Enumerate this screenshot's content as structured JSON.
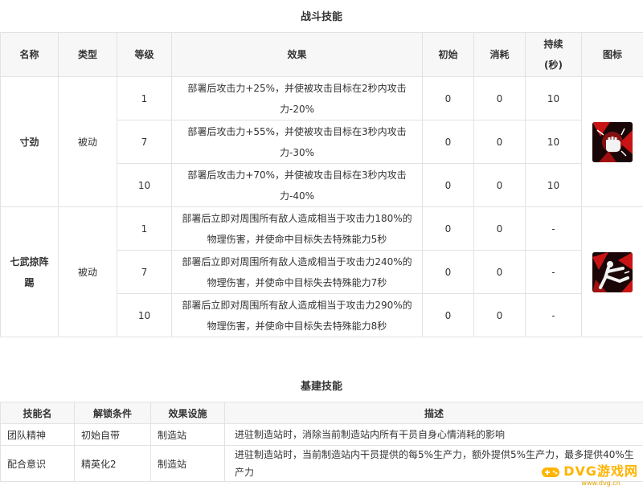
{
  "combat": {
    "title": "战斗技能",
    "headers": {
      "name": "名称",
      "type": "类型",
      "level": "等级",
      "effect": "效果",
      "initial": "初始",
      "cost": "消耗",
      "duration_line1": "持续",
      "duration_line2": "(秒)",
      "icon": "图标"
    },
    "skills": [
      {
        "name": "寸劲",
        "type": "被动",
        "icon": "fist-strike-icon",
        "rows": [
          {
            "level": "1",
            "effect": "部署后攻击力+25%，并使被攻击目标在2秒内攻击力-20%",
            "initial": "0",
            "cost": "0",
            "duration": "10"
          },
          {
            "level": "7",
            "effect": "部署后攻击力+55%，并使被攻击目标在3秒内攻击力-30%",
            "initial": "0",
            "cost": "0",
            "duration": "10"
          },
          {
            "level": "10",
            "effect": "部署后攻击力+70%，并使被攻击目标在3秒内攻击力-40%",
            "initial": "0",
            "cost": "0",
            "duration": "10"
          }
        ]
      },
      {
        "name_line1": "七武掠阵",
        "name_line2": "踢",
        "type": "被动",
        "icon": "kick-strike-icon",
        "rows": [
          {
            "level": "1",
            "effect": "部署后立即对周围所有敌人造成相当于攻击力180%的物理伤害，并使命中目标失去特殊能力5秒",
            "initial": "0",
            "cost": "0",
            "duration": "-"
          },
          {
            "level": "7",
            "effect": "部署后立即对周围所有敌人造成相当于攻击力240%的物理伤害，并使命中目标失去特殊能力7秒",
            "initial": "0",
            "cost": "0",
            "duration": "-"
          },
          {
            "level": "10",
            "effect": "部署后立即对周围所有敌人造成相当于攻击力290%的物理伤害，并使命中目标失去特殊能力8秒",
            "initial": "0",
            "cost": "0",
            "duration": "-"
          }
        ]
      }
    ]
  },
  "base": {
    "title": "基建技能",
    "headers": {
      "skill": "技能名",
      "unlock": "解锁条件",
      "facility": "效果设施",
      "desc": "描述"
    },
    "rows": [
      {
        "skill": "团队精神",
        "unlock": "初始自带",
        "facility": "制造站",
        "desc": "进驻制造站时，消除当前制造站内所有干员自身心情消耗的影响"
      },
      {
        "skill": "配合意识",
        "unlock": "精英化2",
        "facility": "制造站",
        "desc": "进驻制造站时，当前制造站内干员提供的每5%生产力，额外提供5%生产力，最多提供40%生产力"
      }
    ]
  },
  "watermark": {
    "text": "DVG游戏网",
    "sub": "www.dvg.cn"
  },
  "colors": {
    "icon_bg": "#1a0606",
    "icon_red": "#c81414",
    "watermark": "#ffb400"
  }
}
